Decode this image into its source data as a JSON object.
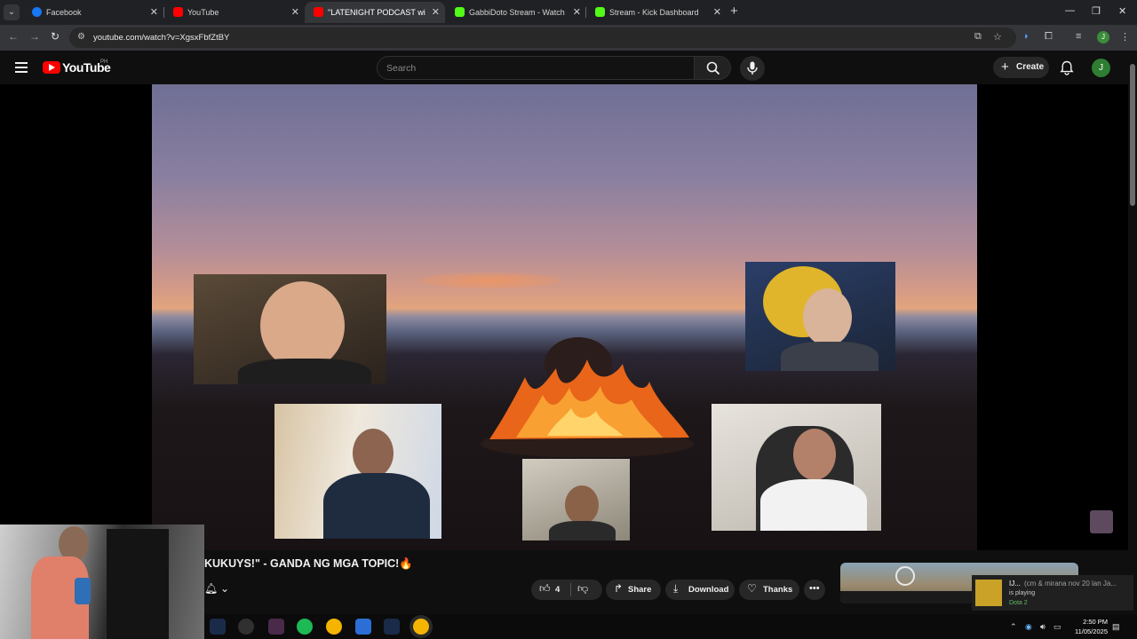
{
  "browser": {
    "tabs": [
      {
        "title": "Facebook",
        "favicon_color": "#1877f2"
      },
      {
        "title": "YouTube",
        "favicon_color": "#ff0000"
      },
      {
        "title": "\"LATENIGHT PODCAST with KU",
        "favicon_color": "#ff0000",
        "active": true
      },
      {
        "title": "GabbiDoto Stream - Watch Live",
        "favicon_color": "#53fc18"
      },
      {
        "title": "Stream - Kick Dashboard",
        "favicon_color": "#53fc18"
      }
    ],
    "url": "youtube.com/watch?v=XgsxFbfZtBY"
  },
  "youtube": {
    "logo_text": "YouTube",
    "country_code": "PH",
    "search_placeholder": "Search",
    "create_label": "Create",
    "avatar_letter": "J"
  },
  "video": {
    "title": "KUKUYS!\" - GANDA NG MGA TOPIC!🔥",
    "like_count": "4",
    "share_label": "Share",
    "download_label": "Download",
    "thanks_label": "Thanks"
  },
  "notification": {
    "name": "IJ...",
    "rich_text": "(cm & mirana nov 20 lan Ja...",
    "status": "is playing",
    "game": "Dota 2"
  },
  "taskbar": {
    "time": "2:50 PM",
    "date": "11/05/2025"
  },
  "colors": {
    "yt_red": "#ff0000",
    "background": "#0f0f0f",
    "pill": "#272727",
    "kick_green": "#53fc18"
  }
}
